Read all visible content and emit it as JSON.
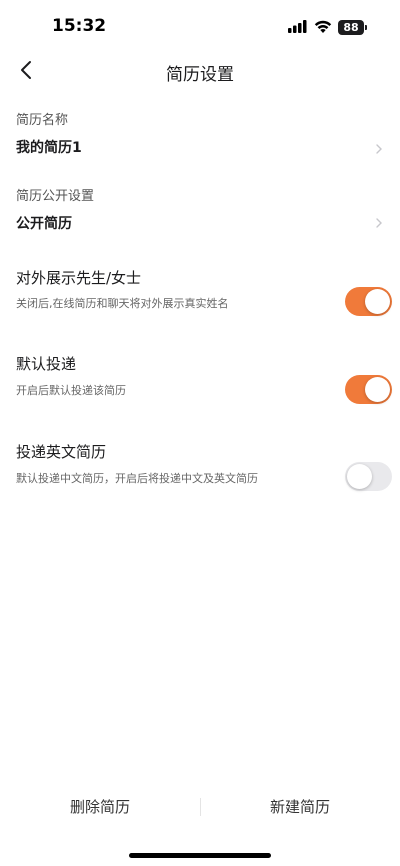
{
  "status_bar": {
    "time": "15:32",
    "battery": "88",
    "icons": [
      "cellular-signal-icon",
      "wifi-icon",
      "battery-icon"
    ]
  },
  "nav": {
    "title": "简历设置",
    "back_icon": "chevron-left-icon"
  },
  "fields": {
    "resume_name": {
      "label": "简历名称",
      "value": "我的简历1"
    },
    "public_setting": {
      "label": "简历公开设置",
      "value": "公开简历"
    }
  },
  "toggles": {
    "display_title": {
      "title": "对外展示先生/女士",
      "desc": "关闭后,在线简历和聊天将对外展示真实姓名",
      "on": true
    },
    "default_delivery": {
      "title": "默认投递",
      "desc": "开启后默认投递该简历",
      "on": true
    },
    "english_resume": {
      "title": "投递英文简历",
      "desc": "默认投递中文简历，开启后将投递中文及英文简历",
      "on": false
    }
  },
  "bottom": {
    "delete_label": "删除简历",
    "new_label": "新建简历"
  },
  "colors": {
    "accent": "#f07a3a",
    "switch_off": "#e9e9ec"
  }
}
